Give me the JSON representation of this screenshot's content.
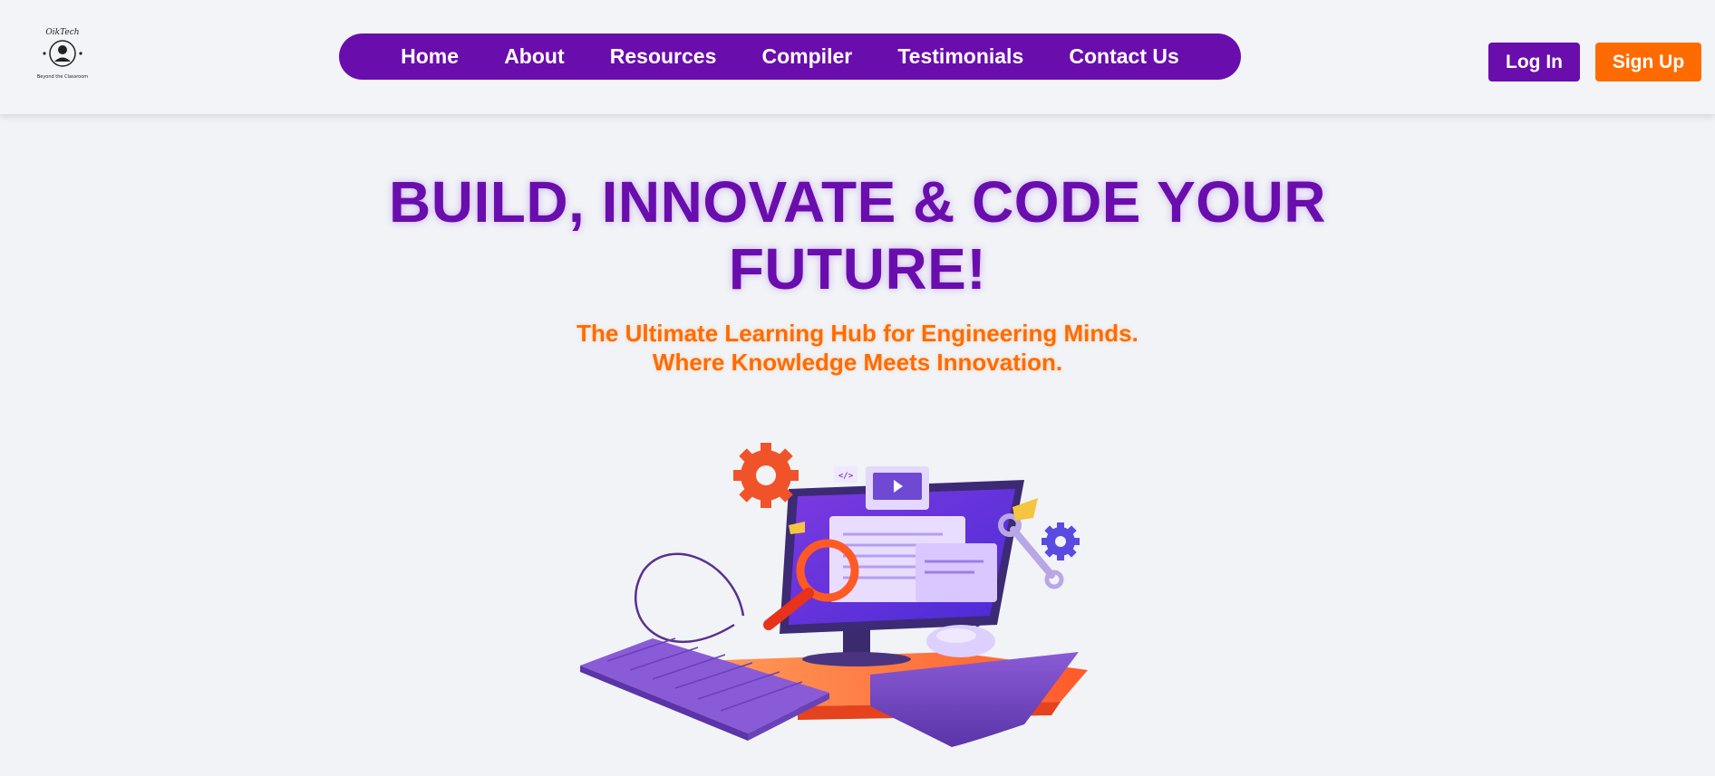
{
  "header": {
    "logo_text": "OikTech",
    "logo_tagline": "Beyond the Classroom",
    "nav": [
      {
        "label": "Home"
      },
      {
        "label": "About"
      },
      {
        "label": "Resources"
      },
      {
        "label": "Compiler"
      },
      {
        "label": "Testimonials"
      },
      {
        "label": "Contact Us"
      }
    ],
    "login_label": "Log In",
    "signup_label": "Sign Up"
  },
  "hero": {
    "title_line1": "BUILD, INNOVATE & CODE YOUR",
    "title_line2": "FUTURE!",
    "subtitle_line1": "The Ultimate Learning Hub for Engineering Minds.",
    "subtitle_line2": "Where Knowledge Meets Innovation."
  },
  "colors": {
    "brand_purple": "#6a0dad",
    "brand_orange": "#ff6b00",
    "background": "#f1f3f6"
  },
  "illustration": {
    "icon": "computer-workspace-illustration",
    "code_tag": "</>"
  }
}
